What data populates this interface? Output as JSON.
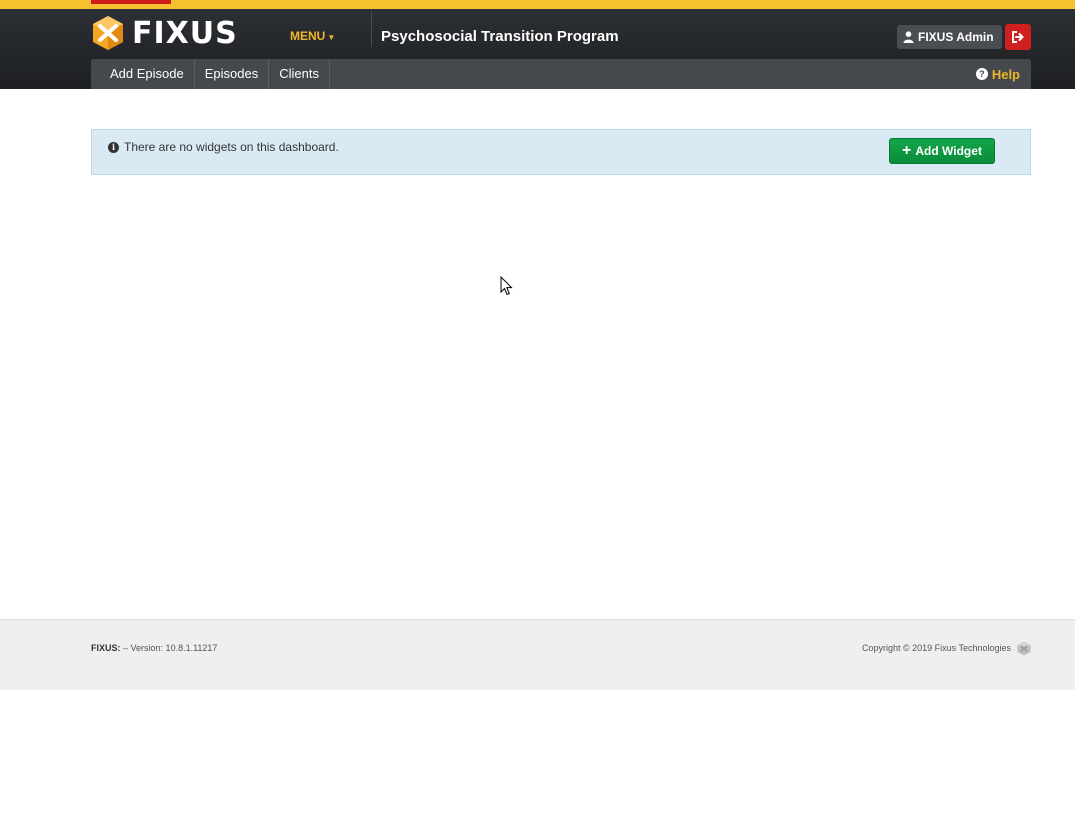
{
  "header": {
    "brand": "FIXUS",
    "menu_label": "MENU",
    "program_title": "Psychosocial Transition Program",
    "user_label": "FIXUS Admin",
    "help_label": "Help"
  },
  "subnav": {
    "items": [
      {
        "label": "Add Episode"
      },
      {
        "label": "Episodes"
      },
      {
        "label": "Clients"
      }
    ]
  },
  "alert": {
    "message": "There are no widgets on this dashboard.",
    "add_widget_label": "Add Widget"
  },
  "footer": {
    "brand": "FIXUS:",
    "version_text": "– Version: 10.8.1.11217",
    "copyright": "Copyright © 2019 Fixus Technologies"
  },
  "colors": {
    "accent": "#f0b62b",
    "header_bg": "#2c2f33",
    "success": "#0b8c3b",
    "danger": "#d01f1f",
    "alert_bg": "#d9eaf5"
  }
}
